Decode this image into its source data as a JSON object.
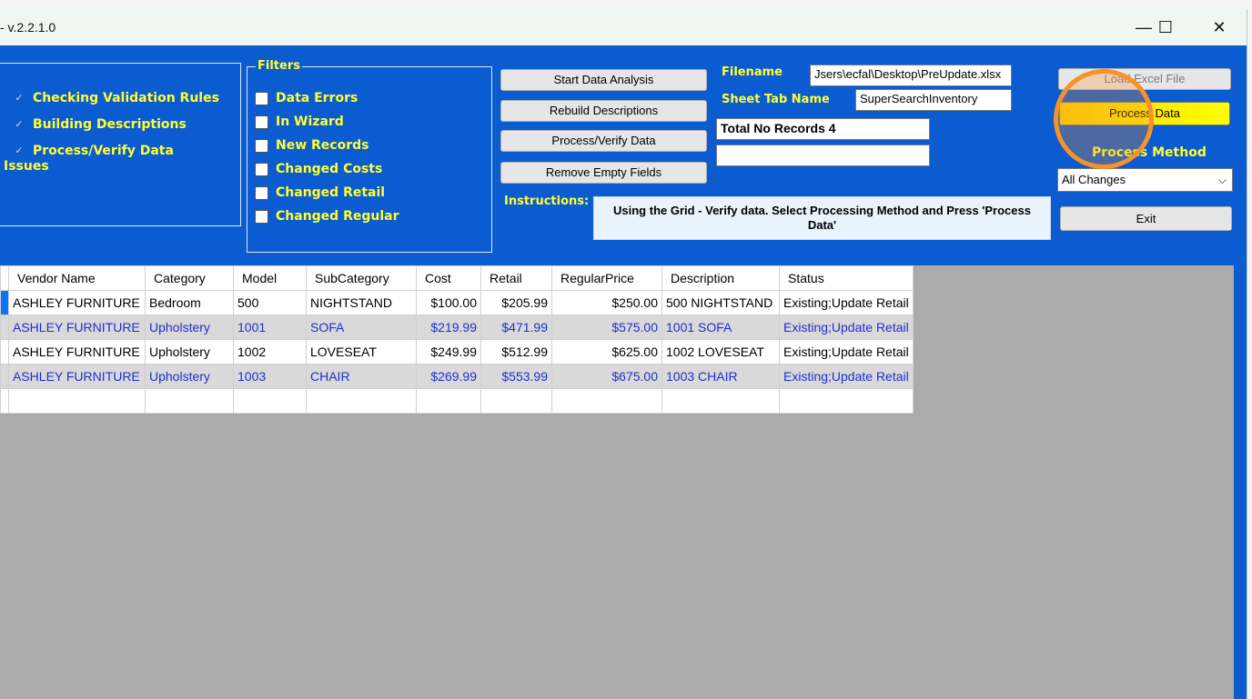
{
  "window": {
    "title": "- v.2.2.1.0",
    "minimize_glyph": "—",
    "maximize_glyph": "☐",
    "close_glyph": "✕"
  },
  "status_panel": {
    "items": [
      "Checking Validation Rules",
      "Building Descriptions",
      "Process/Verify Data"
    ],
    "issues_label": "Issues"
  },
  "filters": {
    "title": "Filters",
    "items": [
      "Data Errors",
      "In Wizard",
      "New Records",
      "Changed Costs",
      "Changed Retail",
      "Changed Regular"
    ]
  },
  "actions": {
    "start_analysis": "Start Data Analysis",
    "rebuild_descriptions": "Rebuild Descriptions",
    "process_verify": "Process/Verify Data",
    "remove_empty": "Remove Empty Fields"
  },
  "file": {
    "filename_label": "Filename",
    "filename_value": "Jsers\\ecfal\\Desktop\\PreUpdate.xlsx",
    "sheet_label": "Sheet Tab Name",
    "sheet_value": "SuperSearchInventory",
    "total_records": "Total No Records 4",
    "extra_value": ""
  },
  "instructions": {
    "label": "Instructions:",
    "text": "Using the Grid - Verify data. Select Processing Method and Press 'Process Data'"
  },
  "right_panel": {
    "load_excel": "Load Excel File",
    "process_data": "Process Data",
    "process_method_label": "Process Method",
    "process_method_value": "All Changes",
    "exit": "Exit"
  },
  "grid": {
    "columns": [
      "Vendor Name",
      "Category",
      "Model",
      "SubCategory",
      "Cost",
      "Retail",
      "RegularPrice",
      "Description",
      "Status"
    ],
    "rows": [
      [
        "ASHLEY FURNITURE",
        "Bedroom",
        "500",
        "NIGHTSTAND",
        "$100.00",
        "$205.99",
        "$250.00",
        "500 NIGHTSTAND",
        "Existing;Update Retail"
      ],
      [
        "ASHLEY FURNITURE",
        "Upholstery",
        "1001",
        "SOFA",
        "$219.99",
        "$471.99",
        "$575.00",
        "1001 SOFA",
        "Existing;Update Retail"
      ],
      [
        "ASHLEY FURNITURE",
        "Upholstery",
        "1002",
        "LOVESEAT",
        "$249.99",
        "$512.99",
        "$625.00",
        "1002 LOVESEAT",
        "Existing;Update Retail"
      ],
      [
        "ASHLEY FURNITURE",
        "Upholstery",
        "1003",
        "CHAIR",
        "$269.99",
        "$553.99",
        "$675.00",
        "1003 CHAIR",
        "Existing;Update Retail"
      ]
    ]
  },
  "colors": {
    "background_blue": "#0b5bd1",
    "label_yellow": "#ffff33",
    "process_button": "#ffd700",
    "highlight_ring": "#f5932a",
    "alt_row_text": "#1e2fd0"
  }
}
